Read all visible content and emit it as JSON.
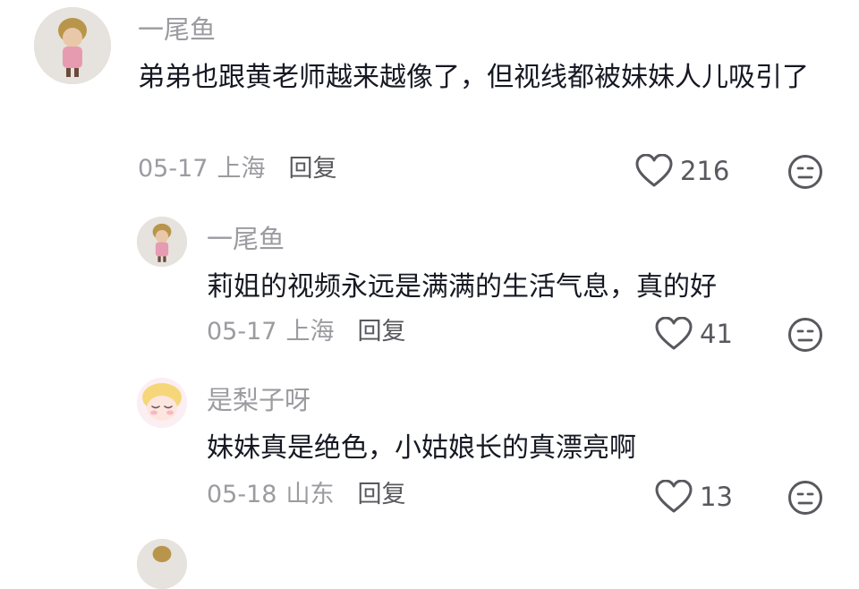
{
  "comments": [
    {
      "username": "一尾鱼",
      "avatar_icon": "doll-avatar-icon",
      "text": "弟弟也跟黄老师越来越像了，但视线都被妹妹人儿吸引了",
      "date": "05-17",
      "location": "上海",
      "reply_label": "回复",
      "likes": "216"
    },
    {
      "username": "一尾鱼",
      "avatar_icon": "doll-avatar-icon",
      "text": "莉姐的视频永远是满满的生活气息，真的好",
      "date": "05-17",
      "location": "上海",
      "reply_label": "回复",
      "likes": "41"
    },
    {
      "username": "是梨子呀",
      "avatar_icon": "cartoon-avatar-icon",
      "text": "妹妹真是绝色，小姑娘长的真漂亮啊",
      "date": "05-18",
      "location": "山东",
      "reply_label": "回复",
      "likes": "13"
    }
  ],
  "colors": {
    "username": "#9b9ba0",
    "text": "#161823",
    "reply": "#58585e"
  }
}
